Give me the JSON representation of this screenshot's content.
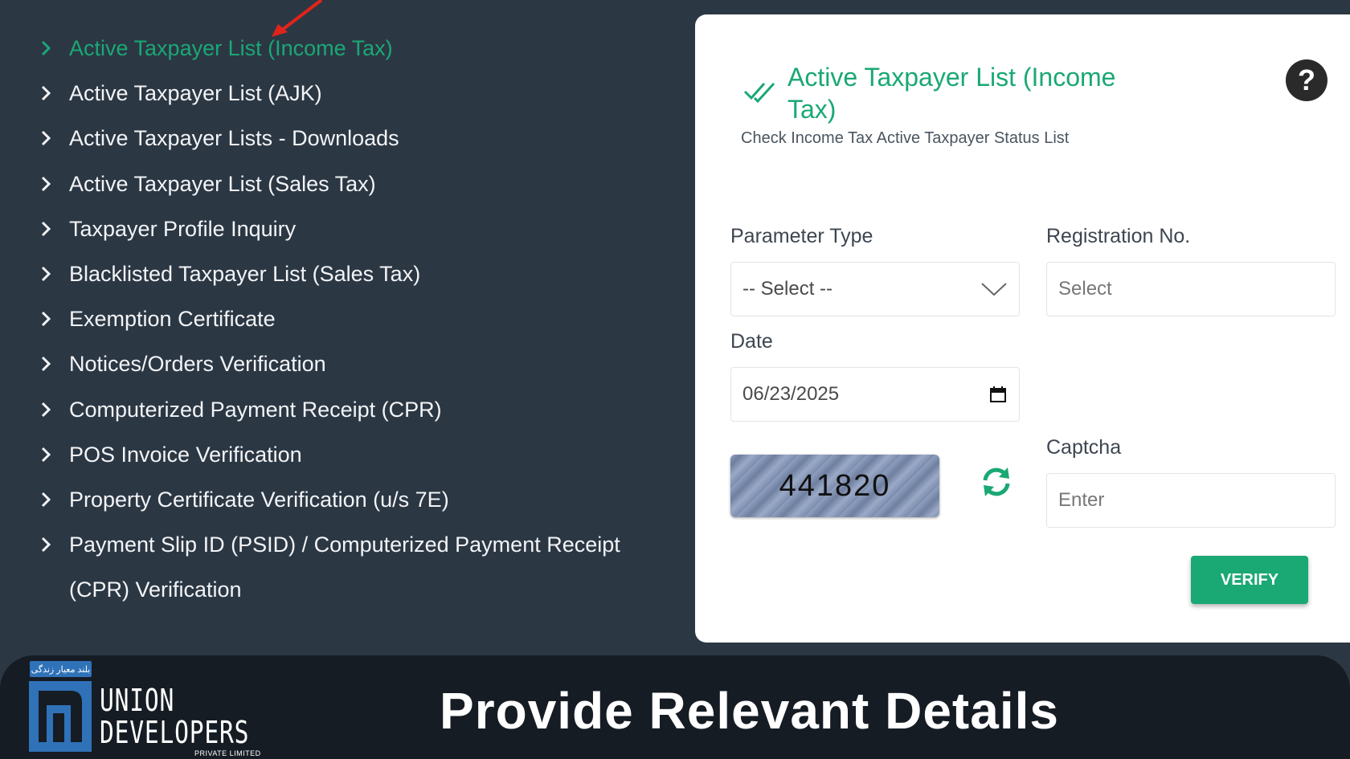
{
  "sidebar": {
    "items": [
      {
        "label": "Active Taxpayer List (Income Tax)",
        "active": true
      },
      {
        "label": "Active Taxpayer List (AJK)"
      },
      {
        "label": "Active Taxpayer Lists - Downloads"
      },
      {
        "label": "Active Taxpayer List (Sales Tax)"
      },
      {
        "label": "Taxpayer Profile Inquiry"
      },
      {
        "label": "Blacklisted Taxpayer List (Sales Tax)"
      },
      {
        "label": "Exemption Certificate"
      },
      {
        "label": "Notices/Orders Verification"
      },
      {
        "label": "Computerized Payment Receipt (CPR)"
      },
      {
        "label": "POS Invoice Verification"
      },
      {
        "label": "Property Certificate Verification (u/s 7E)"
      },
      {
        "label": "Payment Slip ID (PSID) / Computerized Payment Receipt (CPR) Verification"
      }
    ]
  },
  "card": {
    "title": "Active Taxpayer List (Income Tax)",
    "subtitle": "Check Income Tax Active Taxpayer Status List",
    "help_icon": "?",
    "parameter_type": {
      "label": "Parameter Type",
      "value": "-- Select --"
    },
    "registration_no": {
      "label": "Registration No.",
      "placeholder": "Select"
    },
    "date": {
      "label": "Date",
      "value": "06/23/2025"
    },
    "captcha": {
      "label": "Captcha",
      "code": "441820",
      "placeholder": "Enter"
    },
    "verify_label": "VERIFY"
  },
  "banner": {
    "logo_tag": "بلند معیار زندگی",
    "logo_line1": "UNION",
    "logo_line2": "DEVELOPERS",
    "logo_small": "PRIVATE LIMITED",
    "title": "Provide Relevant Details"
  },
  "colors": {
    "background": "#2c3744",
    "accent_green": "#1aa874",
    "banner_bg": "#161c24",
    "logo_blue": "#2f72b8",
    "arrow_red": "#e0241b"
  },
  "icons": [
    "chevron-right-icon",
    "double-check-icon",
    "help-icon",
    "chevron-down-icon",
    "calendar-icon",
    "refresh-icon",
    "red-arrow-annotation"
  ]
}
